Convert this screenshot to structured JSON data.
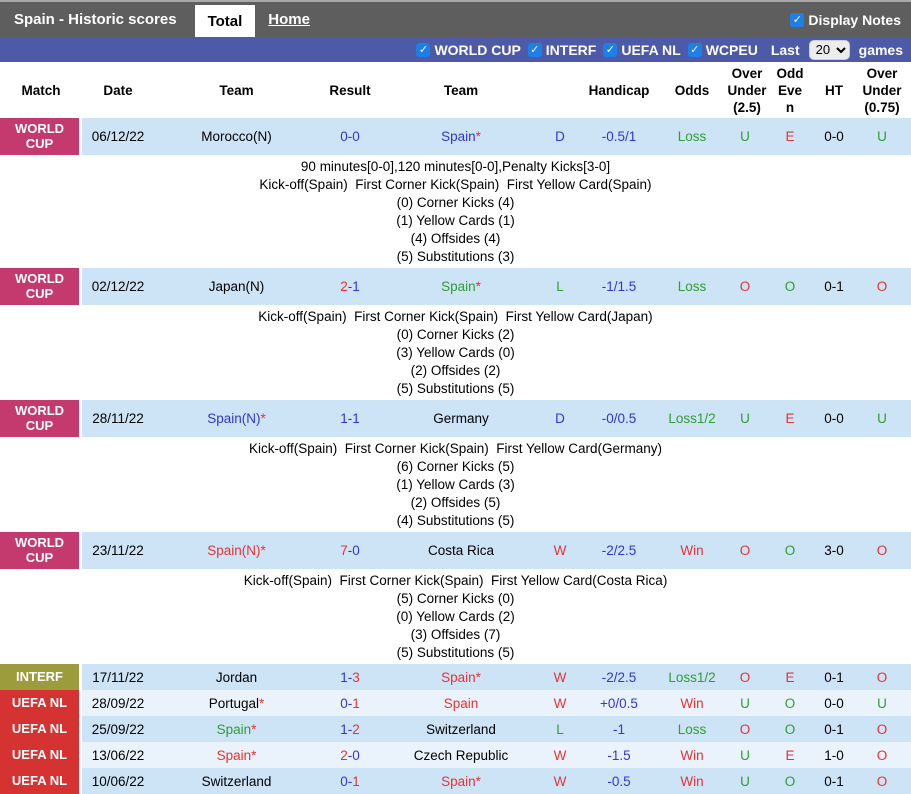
{
  "tabs": {
    "title": "Spain - Historic scores",
    "total": "Total",
    "home": "Home",
    "display_notes": "Display Notes"
  },
  "filters": {
    "competitions": [
      "WORLD CUP",
      "INTERF",
      "UEFA NL",
      "WCPEU"
    ],
    "last_label": "Last",
    "last_value": "20",
    "games_label": "games"
  },
  "colors": {
    "blue": "#3535d1",
    "red": "#e23434",
    "green": "#2f9e30",
    "black": "#000000",
    "badge_worldcup": "#c53a6e",
    "badge_interf": "#9c9c3c",
    "badge_uefanl": "#d53232",
    "topbar": "#5e5e5e",
    "filterbar": "#4d5aa8",
    "checkbox_blue": "#1e7fe8",
    "row_blue": "#cde3f6",
    "row_light": "#eaf3fb"
  },
  "table": {
    "headers": [
      "Match",
      "Date",
      "Team",
      "Result",
      "Team",
      "",
      "Handicap",
      "Odds",
      "Over Under (2.5)",
      "Odd Even",
      "HT",
      "Over Under (0.75)"
    ],
    "rows": [
      {
        "competition": "WORLD CUP",
        "badge": "badge_worldcup",
        "bg": "blue",
        "date": "06/12/22",
        "home": {
          "name": "Morocco(N)",
          "star": false,
          "color": "black"
        },
        "score": {
          "home": "0",
          "away": "0",
          "home_color": "blue",
          "away_color": "blue"
        },
        "away": {
          "name": "Spain",
          "star": true,
          "color": "blue"
        },
        "wld": {
          "text": "D",
          "color": "blue"
        },
        "handicap": "-0.5/1",
        "odds": {
          "text": "Loss",
          "color": "green"
        },
        "ou25": {
          "text": "U",
          "color": "green"
        },
        "oddeven": {
          "text": "E",
          "color": "red"
        },
        "ht": "0-0",
        "ou075": {
          "text": "U",
          "color": "green"
        },
        "notes": [
          "90 minutes[0-0],120 minutes[0-0],Penalty Kicks[3-0]",
          "Kick-off(Spain)  First Corner Kick(Spain)  First Yellow Card(Spain)",
          "(0) Corner Kicks (4)",
          "(1) Yellow Cards (1)",
          "(4) Offsides (4)",
          "(5) Substitutions (3)"
        ]
      },
      {
        "competition": "WORLD CUP",
        "badge": "badge_worldcup",
        "bg": "blue",
        "date": "02/12/22",
        "home": {
          "name": "Japan(N)",
          "star": false,
          "color": "black"
        },
        "score": {
          "home": "2",
          "away": "1",
          "home_color": "red",
          "away_color": "blue"
        },
        "away": {
          "name": "Spain",
          "star": true,
          "color": "green"
        },
        "wld": {
          "text": "L",
          "color": "green"
        },
        "handicap": "-1/1.5",
        "odds": {
          "text": "Loss",
          "color": "green"
        },
        "ou25": {
          "text": "O",
          "color": "red"
        },
        "oddeven": {
          "text": "O",
          "color": "green"
        },
        "ht": "0-1",
        "ou075": {
          "text": "O",
          "color": "red"
        },
        "notes": [
          "Kick-off(Spain)  First Corner Kick(Spain)  First Yellow Card(Japan)",
          "(0) Corner Kicks (2)",
          "(3) Yellow Cards (0)",
          "(2) Offsides (2)",
          "(5) Substitutions (5)"
        ]
      },
      {
        "competition": "WORLD CUP",
        "badge": "badge_worldcup",
        "bg": "blue",
        "date": "28/11/22",
        "home": {
          "name": "Spain(N)",
          "star": true,
          "color": "blue"
        },
        "score": {
          "home": "1",
          "away": "1",
          "home_color": "blue",
          "away_color": "blue"
        },
        "away": {
          "name": "Germany",
          "star": false,
          "color": "black"
        },
        "wld": {
          "text": "D",
          "color": "blue"
        },
        "handicap": "-0/0.5",
        "odds": {
          "text": "Loss1/2",
          "color": "green"
        },
        "ou25": {
          "text": "U",
          "color": "green"
        },
        "oddeven": {
          "text": "E",
          "color": "red"
        },
        "ht": "0-0",
        "ou075": {
          "text": "U",
          "color": "green"
        },
        "notes": [
          "Kick-off(Spain)  First Corner Kick(Spain)  First Yellow Card(Germany)",
          "(6) Corner Kicks (5)",
          "(1) Yellow Cards (3)",
          "(2) Offsides (5)",
          "(4) Substitutions (5)"
        ]
      },
      {
        "competition": "WORLD CUP",
        "badge": "badge_worldcup",
        "bg": "blue",
        "date": "23/11/22",
        "home": {
          "name": "Spain(N)",
          "star": true,
          "color": "red"
        },
        "score": {
          "home": "7",
          "away": "0",
          "home_color": "red",
          "away_color": "blue"
        },
        "away": {
          "name": "Costa Rica",
          "star": false,
          "color": "black"
        },
        "wld": {
          "text": "W",
          "color": "red"
        },
        "handicap": "-2/2.5",
        "odds": {
          "text": "Win",
          "color": "red"
        },
        "ou25": {
          "text": "O",
          "color": "red"
        },
        "oddeven": {
          "text": "O",
          "color": "green"
        },
        "ht": "3-0",
        "ou075": {
          "text": "O",
          "color": "red"
        },
        "notes": [
          "Kick-off(Spain)  First Corner Kick(Spain)  First Yellow Card(Costa Rica)",
          "(5) Corner Kicks (0)",
          "(0) Yellow Cards (2)",
          "(3) Offsides (7)",
          "(5) Substitutions (5)"
        ]
      },
      {
        "competition": "INTERF",
        "badge": "badge_interf",
        "bg": "blue",
        "date": "17/11/22",
        "home": {
          "name": "Jordan",
          "star": false,
          "color": "black"
        },
        "score": {
          "home": "1",
          "away": "3",
          "home_color": "blue",
          "away_color": "red"
        },
        "away": {
          "name": "Spain",
          "star": true,
          "color": "red"
        },
        "wld": {
          "text": "W",
          "color": "red"
        },
        "handicap": "-2/2.5",
        "odds": {
          "text": "Loss1/2",
          "color": "green"
        },
        "ou25": {
          "text": "O",
          "color": "red"
        },
        "oddeven": {
          "text": "E",
          "color": "red"
        },
        "ht": "0-1",
        "ou075": {
          "text": "O",
          "color": "red"
        },
        "notes": []
      },
      {
        "competition": "UEFA NL",
        "badge": "badge_uefanl",
        "bg": "light",
        "date": "28/09/22",
        "home": {
          "name": "Portugal",
          "star": true,
          "color": "black"
        },
        "score": {
          "home": "0",
          "away": "1",
          "home_color": "blue",
          "away_color": "red"
        },
        "away": {
          "name": "Spain",
          "star": false,
          "color": "red"
        },
        "wld": {
          "text": "W",
          "color": "red"
        },
        "handicap": "+0/0.5",
        "odds": {
          "text": "Win",
          "color": "red"
        },
        "ou25": {
          "text": "U",
          "color": "green"
        },
        "oddeven": {
          "text": "O",
          "color": "green"
        },
        "ht": "0-0",
        "ou075": {
          "text": "U",
          "color": "green"
        },
        "notes": []
      },
      {
        "competition": "UEFA NL",
        "badge": "badge_uefanl",
        "bg": "blue",
        "date": "25/09/22",
        "home": {
          "name": "Spain",
          "star": true,
          "color": "green"
        },
        "score": {
          "home": "1",
          "away": "2",
          "home_color": "blue",
          "away_color": "red"
        },
        "away": {
          "name": "Switzerland",
          "star": false,
          "color": "black"
        },
        "wld": {
          "text": "L",
          "color": "green"
        },
        "handicap": "-1",
        "odds": {
          "text": "Loss",
          "color": "green"
        },
        "ou25": {
          "text": "O",
          "color": "red"
        },
        "oddeven": {
          "text": "O",
          "color": "green"
        },
        "ht": "0-1",
        "ou075": {
          "text": "O",
          "color": "red"
        },
        "notes": []
      },
      {
        "competition": "UEFA NL",
        "badge": "badge_uefanl",
        "bg": "light",
        "date": "13/06/22",
        "home": {
          "name": "Spain",
          "star": true,
          "color": "red"
        },
        "score": {
          "home": "2",
          "away": "0",
          "home_color": "red",
          "away_color": "blue"
        },
        "away": {
          "name": "Czech Republic",
          "star": false,
          "color": "black"
        },
        "wld": {
          "text": "W",
          "color": "red"
        },
        "handicap": "-1.5",
        "odds": {
          "text": "Win",
          "color": "red"
        },
        "ou25": {
          "text": "U",
          "color": "green"
        },
        "oddeven": {
          "text": "E",
          "color": "red"
        },
        "ht": "1-0",
        "ou075": {
          "text": "O",
          "color": "red"
        },
        "notes": []
      },
      {
        "competition": "UEFA NL",
        "badge": "badge_uefanl",
        "bg": "blue",
        "date": "10/06/22",
        "home": {
          "name": "Switzerland",
          "star": false,
          "color": "black"
        },
        "score": {
          "home": "0",
          "away": "1",
          "home_color": "blue",
          "away_color": "red"
        },
        "away": {
          "name": "Spain",
          "star": true,
          "color": "red"
        },
        "wld": {
          "text": "W",
          "color": "red"
        },
        "handicap": "-0.5",
        "odds": {
          "text": "Win",
          "color": "red"
        },
        "ou25": {
          "text": "U",
          "color": "green"
        },
        "oddeven": {
          "text": "O",
          "color": "green"
        },
        "ht": "0-1",
        "ou075": {
          "text": "O",
          "color": "red"
        },
        "notes": []
      }
    ]
  }
}
